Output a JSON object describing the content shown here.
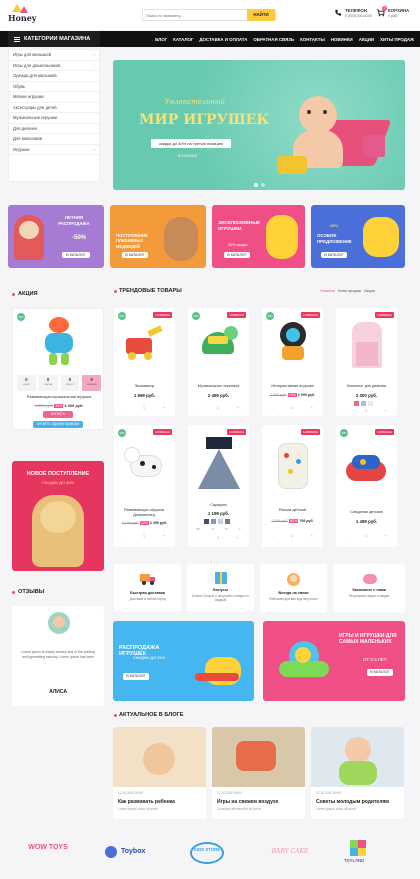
{
  "header": {
    "logo": "Honey",
    "search_placeholder": "Поиск по магазину...",
    "search_button": "НАЙТИ",
    "phone_label": "ТЕЛЕФОН",
    "phone_number": "8 (000) 000-00-00",
    "cart_label": "КОРЗИНА",
    "cart_count": "0",
    "cart_value": "0 руб."
  },
  "nav": {
    "catalog_button": "КАТЕГОРИИ МАГАЗИНА",
    "links": [
      "БЛОГ",
      "КАТАЛОГ",
      "ДОСТАВКА И ОПЛАТА",
      "ОБРАТНАЯ СВЯЗЬ",
      "КОНТАКТЫ",
      "НОВИНКИ",
      "АКЦИИ",
      "ХИТЫ ПРОДАЖ"
    ]
  },
  "sidebar": {
    "items": [
      "Игры для малышей",
      "Игры для дошкольников",
      "Одежда для малышей",
      "Обувь",
      "Мягкие игрушки",
      "Аксессуары для детей",
      "Музыкальные игрушки",
      "Для девочек",
      "Для мальчиков",
      "Игрушки"
    ]
  },
  "hero": {
    "subtitle": "Увлекательный",
    "title": "МИР ИГРУШЕК",
    "discount": "скидка до 40% на третью позицию",
    "button": "В КАТАЛОГ"
  },
  "promos": [
    {
      "title": "ЛЕТНЯЯ РАСПРОДАЖА",
      "extra": "-50%",
      "button": "В КАТАЛОГ",
      "color": "#a67bd4"
    },
    {
      "title": "ПОСТУПЛЕНИЕ ПЛЮШЕВЫХ МЕДВЕДЕЙ",
      "extra": "",
      "button": "В КАТАЛОГ",
      "color": "#f39a3a"
    },
    {
      "title": "ЭКСКЛЮЗИВНЫЕ ИГРУШКИ",
      "extra": "20% скидка",
      "button": "В КАТАЛОГ",
      "color": "#ef4f86"
    },
    {
      "title": "ОСОБОЕ ПРЕДЛОЖЕНИЕ",
      "extra": "-30%",
      "button": "В КАТАЛОГ",
      "color": "#4a6fd9"
    }
  ],
  "sale": {
    "title": "АКЦИЯ",
    "hit": "ХИТ",
    "timer_values": [
      "0",
      "0",
      "0",
      "0"
    ],
    "timer_units": [
      "дней",
      "часов",
      "минут",
      "секунд"
    ],
    "name": "Развивающая музыкальная игрушка",
    "old_price": "4 000 руб.",
    "discount": "25%",
    "price": "3 000 руб.",
    "buy_button": "КУПИТЬ",
    "one_click_button": "КУПИТЬ ОДНИМ КЛИКОМ"
  },
  "new_arrival": {
    "title": "НОВОЕ ПОСТУПЛЕНИЕ",
    "subtitle": "СКИДКИ ДО 40%"
  },
  "reviews": {
    "title": "ОТЗЫВЫ",
    "text": "Lorem Ipsum is simply dummy text of the printing and typesetting industry. Lorem Ipsum has been",
    "name": "АЛИСА"
  },
  "trending": {
    "title": "ТРЕНДОВЫЕ ТОВАРЫ",
    "tabs": [
      "Новинки",
      "Хиты продаж",
      "Акции"
    ],
    "badge_new": "НОВИНКА",
    "badge_hit": "ХИТ",
    "products": [
      {
        "name": "Экскаватор",
        "old": "",
        "disc": "",
        "price": "1 599 руб."
      },
      {
        "name": "Музыкальная черепаха",
        "old": "",
        "disc": "",
        "price": "2 499 руб."
      },
      {
        "name": "Интерактивная игрушка",
        "old": "2 500 руб.",
        "disc": "16%",
        "price": "2 099 руб."
      },
      {
        "name": "Комплект для девочки",
        "old": "",
        "disc": "",
        "price": "2 300 руб."
      },
      {
        "name": "Развивающая игрушка Далматинец",
        "old": "3 199 руб.",
        "disc": "22%",
        "price": "2 499 руб."
      },
      {
        "name": "Сарафан",
        "old": "",
        "disc": "",
        "price": "1 199 руб."
      },
      {
        "name": "Рюкзак детский",
        "old": "1 199 руб.",
        "disc": "80%",
        "price": "799 руб."
      },
      {
        "name": "Сандалии детские",
        "old": "",
        "disc": "",
        "price": "1 499 руб."
      }
    ]
  },
  "features": [
    {
      "title": "Быстрая доставка",
      "text": "Доставка в любой город"
    },
    {
      "title": "Бонусы",
      "text": "Копите бонусы и получайте товары со скидкой"
    },
    {
      "title": "Всегда на связи",
      "text": "Работаем для вас круглосуточно"
    },
    {
      "title": "Экономьте с нами",
      "text": "Регулярные акции и скидки"
    }
  ],
  "banners": [
    {
      "title": "РАСПРОДАЖА ИГРУШЕК",
      "subtitle": "СКИДКИ ДО 25%",
      "button": "В КАТАЛОГ"
    },
    {
      "title": "ИГРЫ И ИГРУШКИ ДЛЯ САМЫХ МАЛЕНЬКИХ",
      "subtitle": "ОТ 0-3 ЛЕТ",
      "button": "В КАТАЛОГ"
    }
  ],
  "blog": {
    "title": "АКТУАЛЬНОЕ В БЛОГЕ",
    "posts": [
      {
        "date": "12.10.2020 00:00",
        "title": "Как развивать ребенка",
        "text": "Lorem ipsum dolor sit amet"
      },
      {
        "date": "12.10.2020 00:00",
        "title": "Игры на свежем воздухе",
        "text": "Curabitur elementum at lorem"
      },
      {
        "date": "12.10.2020 00:00",
        "title": "Советы молодым родителям",
        "text": "Lorem ipsum dolor sit amet"
      }
    ]
  },
  "brands": [
    "WOW TOYS",
    "Toybox",
    "KIDS STORE",
    "BABY CAKE",
    "TOYLAND"
  ]
}
